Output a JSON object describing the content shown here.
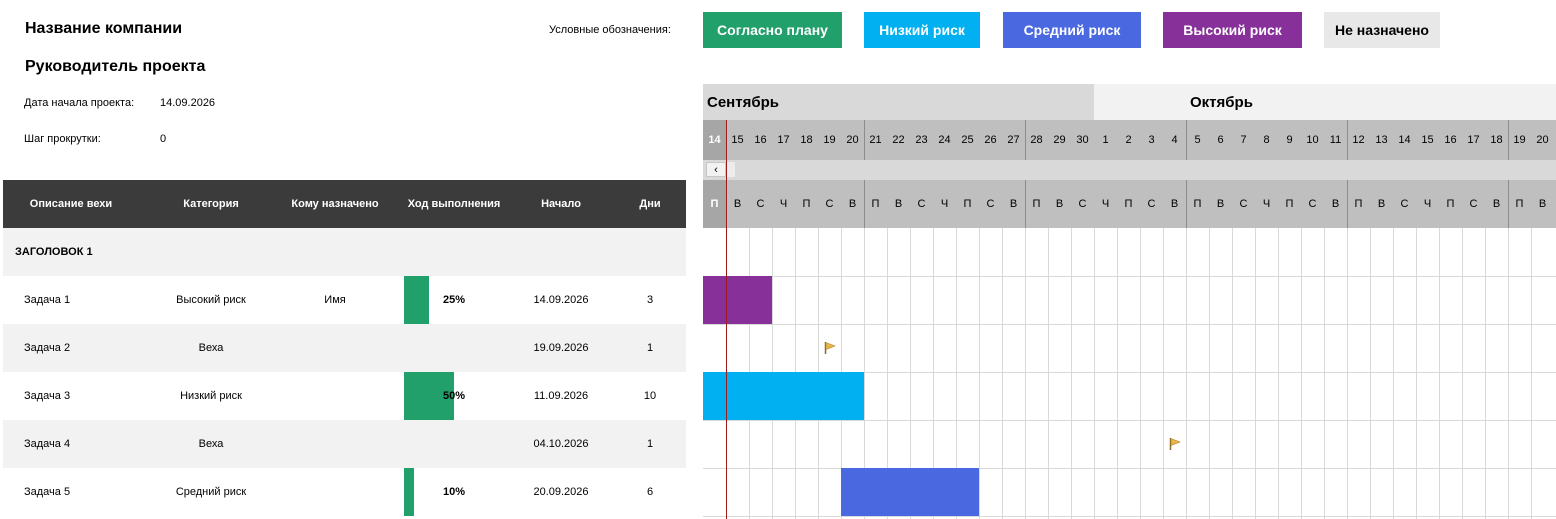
{
  "header": {
    "company": "Название компании",
    "manager": "Руководитель проекта",
    "start_label": "Дата начала проекта:",
    "start_value": "14.09.2026",
    "scroll_label": "Шаг прокрутки:",
    "scroll_value": "0"
  },
  "legend": {
    "label": "Условные обозначения:",
    "items": [
      {
        "label": "Согласно плану",
        "color": "#22a06b"
      },
      {
        "label": "Низкий риск",
        "color": "#00b0f0"
      },
      {
        "label": "Средний риск",
        "color": "#4a68e0"
      },
      {
        "label": "Высокий риск",
        "color": "#87309a"
      },
      {
        "label": "Не назначено",
        "color": "#e8e8e8"
      }
    ]
  },
  "table": {
    "columns": [
      "Описание вехи",
      "Категория",
      "Кому назначено",
      "Ход выполнения",
      "Начало",
      "Дни"
    ],
    "section": "ЗАГОЛОВОК 1",
    "rows": [
      {
        "name": "Задача 1",
        "category": "Высокий риск",
        "assignee": "Имя",
        "progress": "25%",
        "progress_value": 0.25,
        "start": "14.09.2026",
        "days": "3"
      },
      {
        "name": "Задача 2",
        "category": "Веха",
        "assignee": "",
        "progress": "",
        "progress_value": 0,
        "start": "19.09.2026",
        "days": "1"
      },
      {
        "name": "Задача 3",
        "category": "Низкий риск",
        "assignee": "",
        "progress": "50%",
        "progress_value": 0.5,
        "start": "11.09.2026",
        "days": "10"
      },
      {
        "name": "Задача 4",
        "category": "Веха",
        "assignee": "",
        "progress": "",
        "progress_value": 0,
        "start": "04.10.2026",
        "days": "1"
      },
      {
        "name": "Задача 5",
        "category": "Средний риск",
        "assignee": "",
        "progress": "10%",
        "progress_value": 0.1,
        "start": "20.09.2026",
        "days": "6"
      }
    ]
  },
  "gantt": {
    "months": [
      {
        "label": "Сентябрь",
        "start_index": 0,
        "end_index": 16
      },
      {
        "label": "Октябрь",
        "start_index": 17,
        "end_index": 36
      }
    ],
    "days": [
      "14",
      "15",
      "16",
      "17",
      "18",
      "19",
      "20",
      "21",
      "22",
      "23",
      "24",
      "25",
      "26",
      "27",
      "28",
      "29",
      "30",
      "1",
      "2",
      "3",
      "4",
      "5",
      "6",
      "7",
      "8",
      "9",
      "10",
      "11",
      "12",
      "13",
      "14",
      "15",
      "16",
      "17",
      "18",
      "19",
      "20"
    ],
    "weekdays": [
      "П",
      "В",
      "С",
      "Ч",
      "П",
      "С",
      "В",
      "П",
      "В",
      "С",
      "Ч",
      "П",
      "С",
      "В",
      "П",
      "В",
      "С",
      "Ч",
      "П",
      "С",
      "В",
      "П",
      "В",
      "С",
      "Ч",
      "П",
      "С",
      "В",
      "П",
      "В",
      "С",
      "Ч",
      "П",
      "С",
      "В",
      "П",
      "В"
    ],
    "scroll_left": "‹",
    "today_index": 0,
    "bars": [
      {
        "row": 0,
        "start_index": 0,
        "length": 3,
        "color": "#87309a"
      },
      {
        "row": 2,
        "start_index": 0,
        "length": 7,
        "color": "#00b0f0"
      },
      {
        "row": 4,
        "start_index": 6,
        "length": 6,
        "color": "#4a68e0"
      }
    ],
    "milestones": [
      {
        "row": 1,
        "index": 5
      },
      {
        "row": 3,
        "index": 20
      }
    ]
  }
}
